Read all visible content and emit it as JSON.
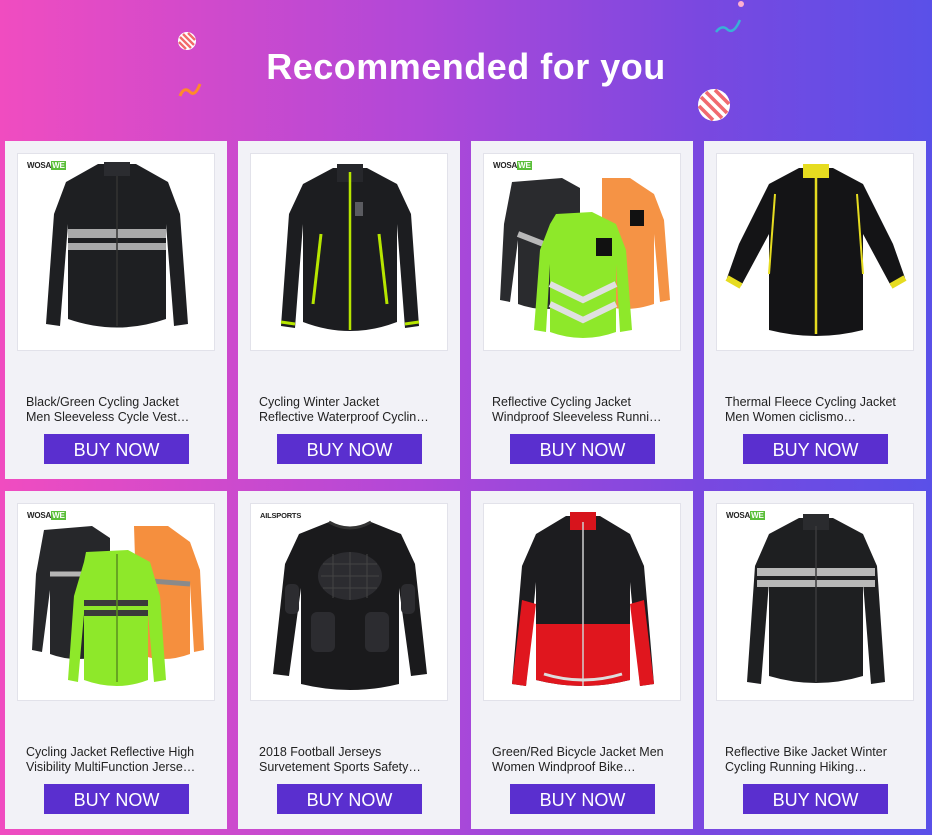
{
  "header": {
    "title": "Recommended for you"
  },
  "products": [
    {
      "name_line1": "Black/Green Cycling Jacket",
      "name_line2": "Men Sleeveless Cycle Vest…",
      "button": "BUY NOW",
      "brand": "WOSAWE",
      "icon": "black-cycling-jacket-image"
    },
    {
      "name_line1": "Cycling Winter Jacket",
      "name_line2": "Reflective Waterproof Cyclin…",
      "button": "BUY NOW",
      "brand": "",
      "icon": "winter-cycling-jacket-image"
    },
    {
      "name_line1": "Reflective Cycling Jacket",
      "name_line2": "Windproof Sleeveless Runni…",
      "button": "BUY NOW",
      "brand": "WOSAWE",
      "icon": "reflective-jackets-image"
    },
    {
      "name_line1": "Thermal Fleece Cycling Jacket",
      "name_line2": "Men Women ciclismo…",
      "button": "BUY NOW",
      "brand": "",
      "icon": "thermal-fleece-jacket-image"
    },
    {
      "name_line1": "Cycling Jacket Reflective High",
      "name_line2": "Visibility MultiFunction Jerse…",
      "button": "BUY NOW",
      "brand": "WOSAWE",
      "icon": "high-visibility-jackets-image"
    },
    {
      "name_line1": "2018 Football Jerseys",
      "name_line2": "Survetement Sports Safety…",
      "button": "BUY NOW",
      "brand": "AILSPORTS",
      "icon": "padded-football-jersey-image"
    },
    {
      "name_line1": "Green/Red Bicycle Jacket Men",
      "name_line2": "Women Windproof Bike…",
      "button": "BUY NOW",
      "brand": "",
      "icon": "red-bicycle-jacket-image"
    },
    {
      "name_line1": "Reflective Bike Jacket Winter",
      "name_line2": "Cycling Running Hiking…",
      "button": "BUY NOW",
      "brand": "WOSAWE",
      "icon": "reflective-bike-jacket-image"
    }
  ],
  "colors": {
    "button": "#5a2fcf",
    "card": "#f2f2f7",
    "title": "#ffffff"
  }
}
